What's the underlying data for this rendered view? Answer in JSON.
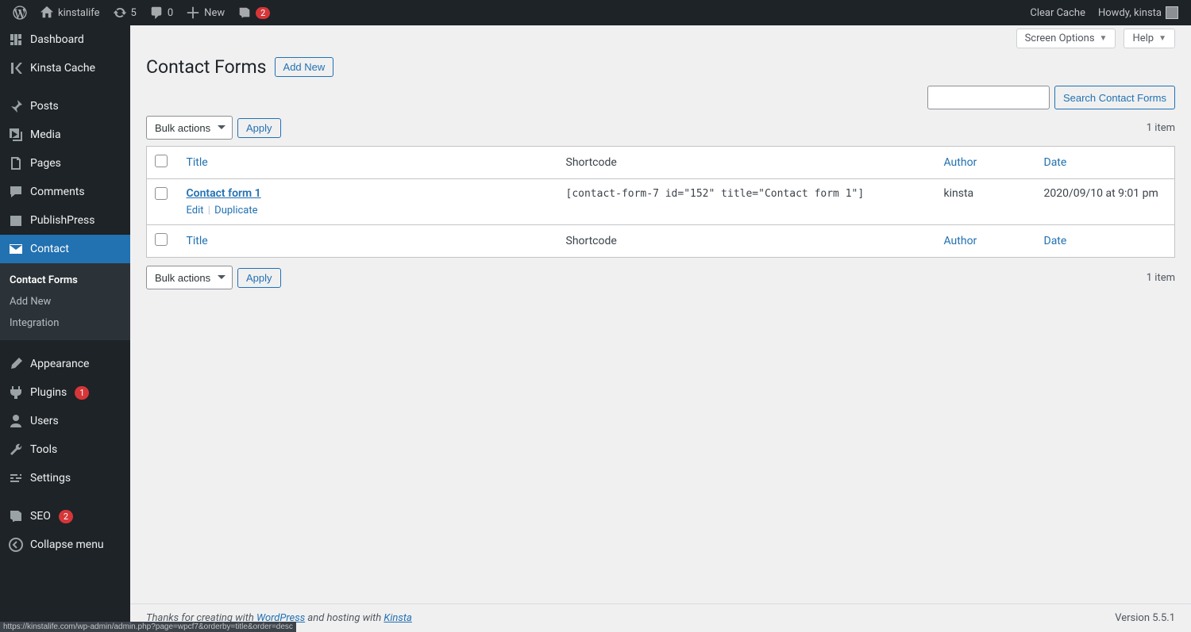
{
  "adminbar": {
    "site_name": "kinstalife",
    "updates_count": "5",
    "comments_count": "0",
    "new_label": "New",
    "yoast_badge": "2",
    "clear_cache": "Clear Cache",
    "howdy": "Howdy, kinsta"
  },
  "sidebar": {
    "dashboard": "Dashboard",
    "kinsta_cache": "Kinsta Cache",
    "posts": "Posts",
    "media": "Media",
    "pages": "Pages",
    "comments": "Comments",
    "publishpress": "PublishPress",
    "contact": "Contact",
    "appearance": "Appearance",
    "plugins": "Plugins",
    "plugins_badge": "1",
    "users": "Users",
    "tools": "Tools",
    "settings": "Settings",
    "seo": "SEO",
    "seo_badge": "2",
    "collapse": "Collapse menu",
    "submenu": {
      "contact_forms": "Contact Forms",
      "add_new": "Add New",
      "integration": "Integration"
    }
  },
  "page": {
    "top_tabs": {
      "screen_options": "Screen Options",
      "help": "Help"
    },
    "title": "Contact Forms",
    "add_new": "Add New",
    "search_btn": "Search Contact Forms",
    "bulk_label": "Bulk actions",
    "apply": "Apply",
    "count": "1 item",
    "columns": {
      "title": "Title",
      "shortcode": "Shortcode",
      "author": "Author",
      "date": "Date"
    },
    "row": {
      "title": "Contact form 1",
      "edit": "Edit",
      "duplicate": "Duplicate",
      "shortcode": "[contact-form-7 id=\"152\" title=\"Contact form 1\"]",
      "author": "kinsta",
      "date": "2020/09/10 at 9:01 pm"
    }
  },
  "footer": {
    "thanks_pre": "Thanks for creating with ",
    "wordpress": "WordPress",
    "thanks_mid": " and hosting with ",
    "kinsta": "Kinsta",
    "version": "Version 5.5.1"
  },
  "status_url": "https://kinstalife.com/wp-admin/admin.php?page=wpcf7&orderby=title&order=desc"
}
